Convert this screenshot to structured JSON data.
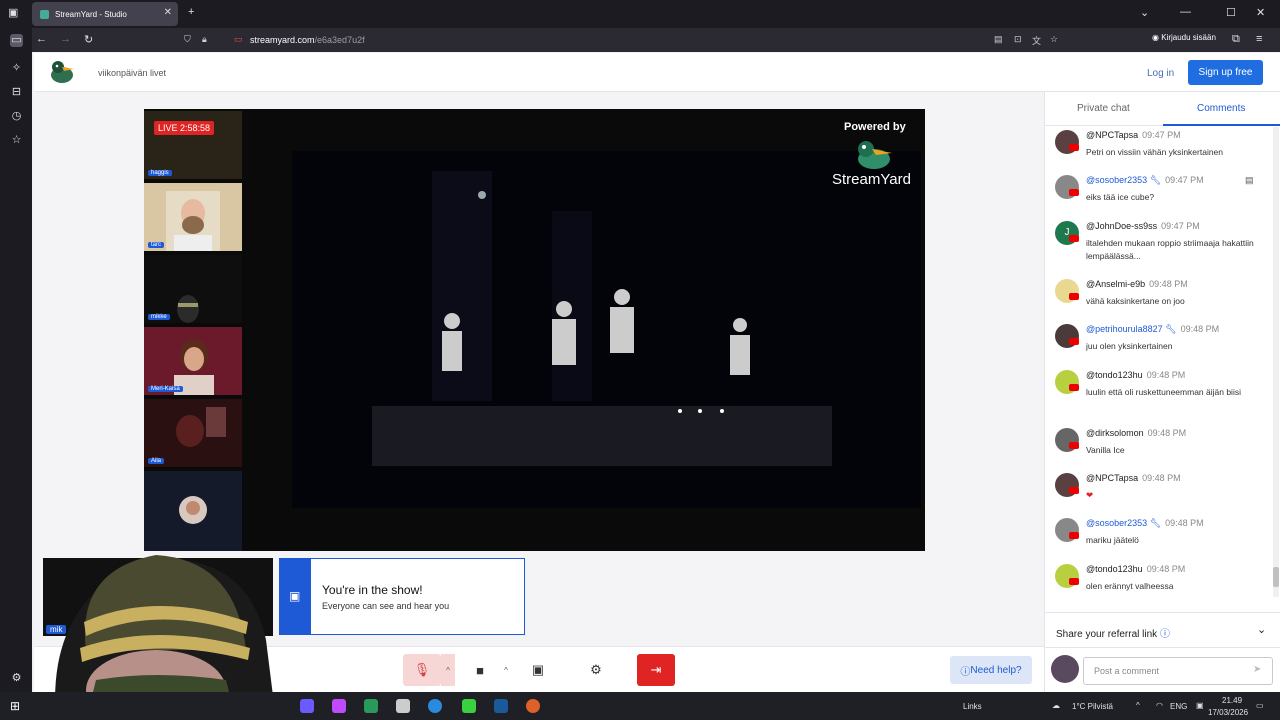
{
  "browser": {
    "tab_title": "StreamYard - Studio",
    "url_host": "streamyard.com",
    "url_path": "/e6a3ed7u2f",
    "signin_label": "Kirjaudu sisään"
  },
  "header": {
    "studio_name": "viikonpäivän livet",
    "login_label": "Log in",
    "signup_label": "Sign up free"
  },
  "stage": {
    "live_label": "LIVE 2:58:58",
    "powered_by": "Powered by",
    "brand": "StreamYard",
    "participants": [
      "haggis",
      "tarc",
      "mikke",
      "Meri-Kaisa",
      "Aila"
    ]
  },
  "self_cam": {
    "name": "mik"
  },
  "notice": {
    "title": "You're in the show!",
    "subtitle": "Everyone can see and hear you"
  },
  "controls": {
    "help_label": "Need help?"
  },
  "panel": {
    "tabs": [
      "Private chat",
      "Comments"
    ],
    "active_tab": "Comments",
    "comments": [
      {
        "author": "@NPCTapsa",
        "time": "09:47 PM",
        "text": "Petri on vissiin vähän yksinkertainen",
        "mod": false
      },
      {
        "author": "@sosober2353",
        "time": "09:47 PM",
        "text": "eiks tää ice cube?",
        "mod": true
      },
      {
        "author": "@JohnDoe-ss9ss",
        "time": "09:47 PM",
        "text": "iltalehden mukaan roppio striimaaja hakattiin lempäälässä...",
        "mod": false
      },
      {
        "author": "@Anselmi-e9b",
        "time": "09:48 PM",
        "text": "vähä kaksinkertane on joo",
        "mod": false
      },
      {
        "author": "@petrihourula8827",
        "time": "09:48 PM",
        "text": "juu olen yksinkertainen",
        "mod": true
      },
      {
        "author": "@tondo123hu",
        "time": "09:48 PM",
        "text": "luulin että oli ruskettuneemman äijän biisi",
        "mod": false
      },
      {
        "author": "@dirksolomon",
        "time": "09:48 PM",
        "text": "Vanilla Ice",
        "mod": false
      },
      {
        "author": "@NPCTapsa",
        "time": "09:48 PM",
        "text": "❤",
        "mod": false
      },
      {
        "author": "@sosober2353",
        "time": "09:48 PM",
        "text": "mariku jäätelö",
        "mod": true
      },
      {
        "author": "@tondo123hu",
        "time": "09:48 PM",
        "text": "olen erännyt valheessa",
        "mod": false
      }
    ],
    "share_label": "Share your referral link",
    "post_placeholder": "Post a comment"
  },
  "taskbar": {
    "links_label": "Links",
    "weather": "1°C  Pilvistä",
    "lang": "ENG",
    "time": "21.49",
    "date": "17/03/2026"
  },
  "colors": {
    "accent": "#1f6de0",
    "live": "#e02424",
    "danger": "#e02424"
  }
}
